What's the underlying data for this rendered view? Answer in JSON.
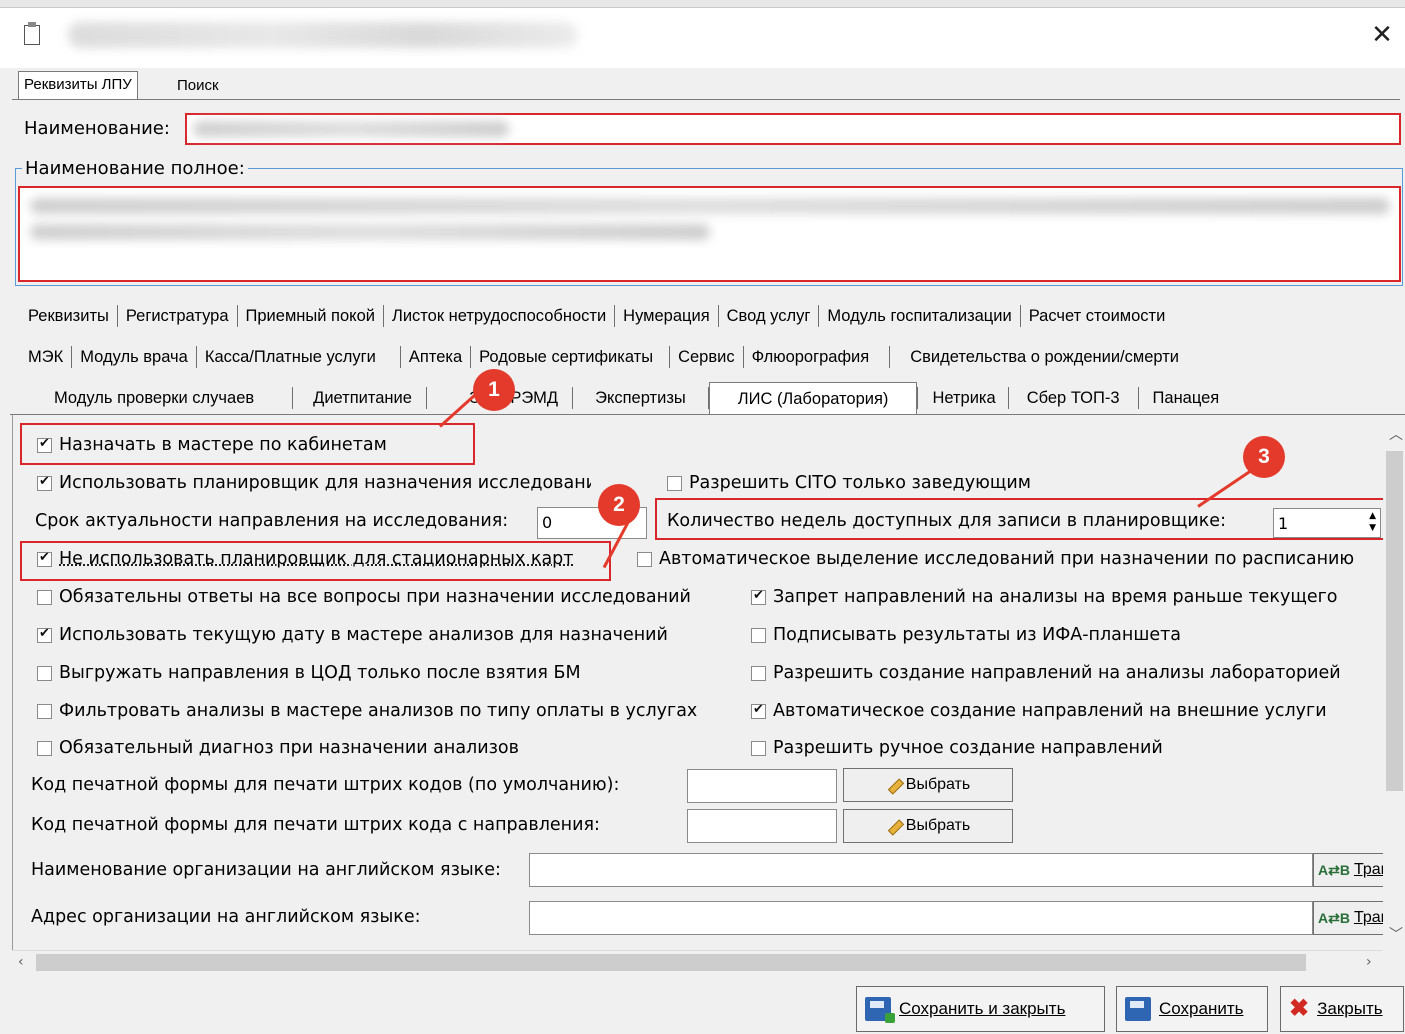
{
  "window": {
    "close_symbol": "✕"
  },
  "top_tabs": {
    "requisites": "Реквизиты ЛПУ",
    "search": "Поиск"
  },
  "name": {
    "label": "Наименование:",
    "full_label": "Наименование полное:"
  },
  "module_tabs": {
    "row1": [
      "Реквизиты",
      "Регистратура",
      "Приемный покой",
      "Листок нетрудоспособности",
      "Нумерация",
      "Свод услуг",
      "Модуль госпитализации",
      "Расчет стоимости"
    ],
    "row2": [
      "МЭК",
      "Модуль врача",
      "Касса/Платные услуги",
      "Аптека",
      "Родовые сертификаты",
      "Сервис",
      "Флюорография",
      "Свидетельства о рождении/смерти"
    ],
    "row3": [
      "Модуль проверки случаев",
      "Диетпитание",
      "ЭМД/РЭМД",
      "Экспертизы",
      "ЛИС (Лаборатория)",
      "Нетрика",
      "Сбер ТОП-3",
      "Панацея"
    ]
  },
  "lis": {
    "assign_by_cabinets": "Назначать в мастере по кабинетам",
    "use_scheduler": "Использовать планировщик для назначения исследований",
    "cito_only_heads": "Разрешить CITO только заведующим",
    "validity_label": "Срок актуальности направления на исследования:",
    "validity_value": "0",
    "weeks_label": "Количество недель доступных для записи в планировщике:",
    "weeks_value": "1",
    "no_scheduler_inpatient": "Не использовать планировщик для стационарных карт",
    "auto_select_schedule": "Автоматическое выделение исследований при назначении по расписанию",
    "mandatory_answers": "Обязательны ответы на все вопросы при назначении исследований",
    "forbid_past_time": "Запрет направлений на анализы на время раньше текущего",
    "use_current_date": "Использовать текущую дату в мастере анализов для назначений",
    "sign_ifa_results": "Подписывать результаты из ИФА-планшета",
    "upload_after_bm": "Выгружать направления в ЦОД только после взятия БМ",
    "allow_lab_creation": "Разрешить создание направлений на анализы лабораторией",
    "filter_by_payment": "Фильтровать анализы в мастере анализов по типу оплаты в услугах",
    "auto_external": "Автоматическое создание направлений на внешние услуги",
    "mandatory_diagnosis": "Обязательный диагноз при назначении анализов",
    "allow_manual": "Разрешить ручное создание направлений",
    "barcode_default_label": "Код печатной формы для печати штрих кодов (по умолчанию):",
    "barcode_referral_label": "Код печатной формы для печати штрих кода с направления:",
    "select_button": "Выбрать",
    "org_name_en_label": "Наименование организации на английском языке:",
    "org_address_en_label": "Адрес организации на английском языке:",
    "translit_button": "Тран"
  },
  "annotations": [
    "1",
    "2",
    "3"
  ],
  "buttons": {
    "save_close": "Сохранить и закрыть",
    "save": "Сохранить",
    "close": "Закрыть"
  }
}
